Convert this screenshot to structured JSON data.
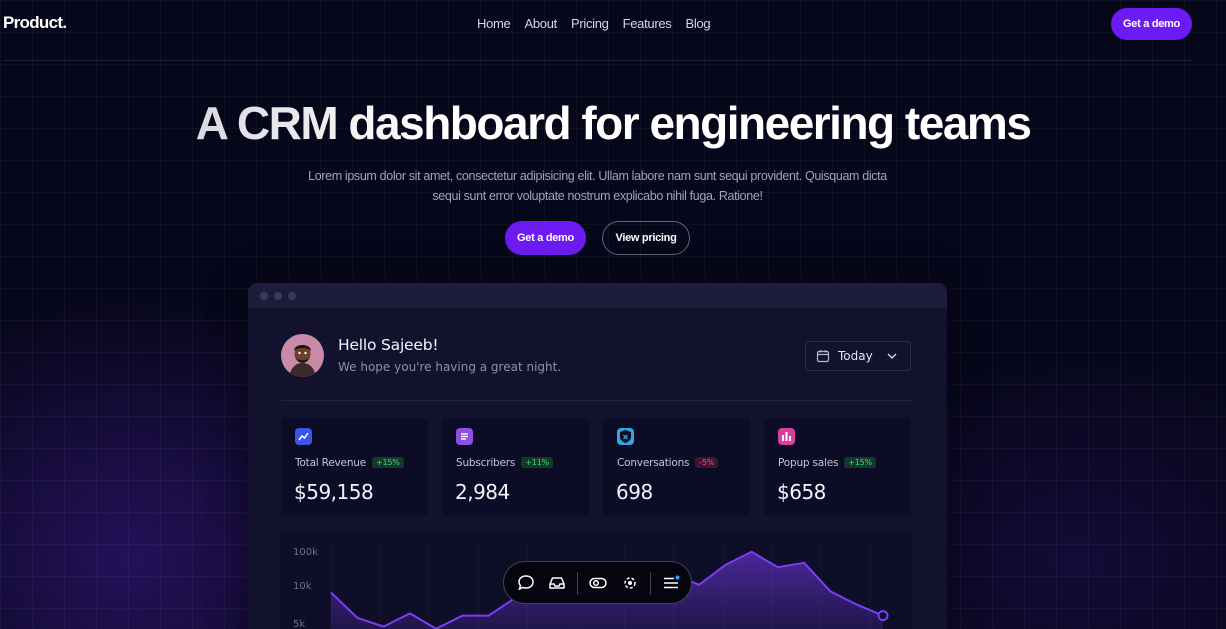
{
  "nav": {
    "brand": "Product.",
    "links": [
      "Home",
      "About",
      "Pricing",
      "Features",
      "Blog"
    ],
    "cta": "Get a demo"
  },
  "hero": {
    "title": "A CRM dashboard for engineering teams",
    "subtitle": "Lorem ipsum dolor sit amet, consectetur adipisicing elit. Ullam labore nam sunt sequi provident. Quisquam dicta sequi sunt error voluptate nostrum explicabo nihil fuga. Ratione!",
    "primary_cta": "Get a demo",
    "secondary_cta": "View pricing"
  },
  "dashboard": {
    "greeting": "Hello Sajeeb!",
    "greeting_sub": "We hope you're having a great night.",
    "date_filter": "Today",
    "stats": [
      {
        "label": "Total Revenue",
        "change": "+15%",
        "trend": "up",
        "value": "$59,158",
        "icon": "chart-icon",
        "color": "#3b55e6"
      },
      {
        "label": "Subscribers",
        "change": "+11%",
        "trend": "up",
        "value": "2,984",
        "icon": "document-icon",
        "color": "#8e4fe3"
      },
      {
        "label": "Conversations",
        "change": "-5%",
        "trend": "down",
        "value": "698",
        "icon": "shield-icon",
        "color": "#2fa8e0"
      },
      {
        "label": "Popup sales",
        "change": "+15%",
        "trend": "up",
        "value": "$658",
        "icon": "bar-chart-icon",
        "color": "#d83fa0"
      }
    ]
  },
  "chart_data": {
    "type": "area",
    "y_tick_labels": [
      "100k",
      "10k",
      "5k"
    ],
    "series": [
      {
        "values": [
          5.5,
          3.2,
          2.4,
          3.6,
          2.2,
          3.4,
          3.4,
          5.0,
          6.6,
          7.4,
          6.0,
          5.6,
          5.6,
          7.2,
          6.2,
          8.0,
          9.2,
          7.8,
          8.2,
          5.6,
          4.4,
          3.4
        ]
      }
    ],
    "color": "#7b3df5"
  },
  "toolbar": {
    "icons": [
      "chat-icon",
      "inbox-icon",
      "toggle-icon",
      "broadcast-icon",
      "menu-icon"
    ]
  }
}
